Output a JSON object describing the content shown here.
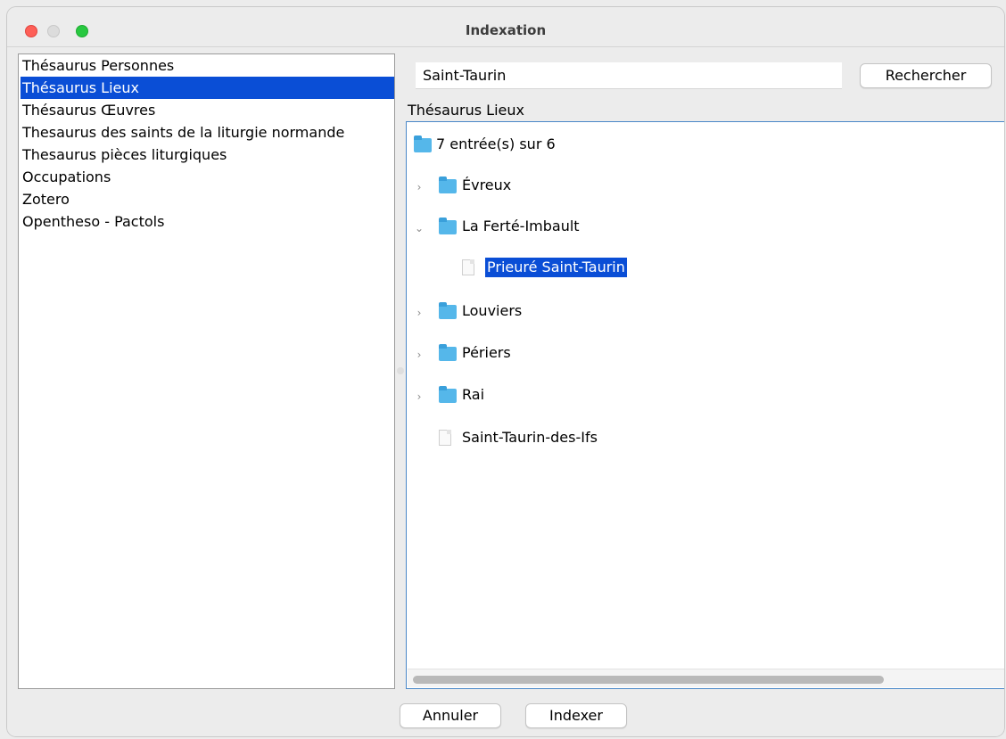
{
  "window": {
    "title": "Indexation"
  },
  "thesaurus_list": {
    "items": [
      {
        "label": "Thésaurus Personnes",
        "selected": false
      },
      {
        "label": "Thésaurus Lieux",
        "selected": true
      },
      {
        "label": "Thésaurus Œuvres",
        "selected": false
      },
      {
        "label": "Thesaurus des saints de la liturgie normande",
        "selected": false
      },
      {
        "label": "Thesaurus pièces liturgiques",
        "selected": false
      },
      {
        "label": "Occupations",
        "selected": false
      },
      {
        "label": "Zotero",
        "selected": false
      },
      {
        "label": "Opentheso - Pactols",
        "selected": false
      }
    ]
  },
  "search": {
    "value": "Saint-Taurin",
    "button_label": "Rechercher"
  },
  "tree": {
    "label": "Thésaurus Lieux",
    "root": "7 entrée(s) sur 6",
    "nodes": [
      {
        "label": "Évreux",
        "type": "folder",
        "state": "collapsed"
      },
      {
        "label": "La Ferté-Imbault",
        "type": "folder",
        "state": "expanded"
      },
      {
        "label": "Prieuré Saint-Taurin",
        "type": "leaf",
        "selected": true
      },
      {
        "label": "Louviers",
        "type": "folder",
        "state": "collapsed"
      },
      {
        "label": "Périers",
        "type": "folder",
        "state": "collapsed"
      },
      {
        "label": "Rai",
        "type": "folder",
        "state": "collapsed"
      },
      {
        "label": "Saint-Taurin-des-Ifs",
        "type": "leaf"
      }
    ]
  },
  "actions": {
    "cancel_label": "Annuler",
    "index_label": "Indexer"
  },
  "icons": {
    "folder": "folder-icon",
    "document": "document-icon",
    "chevron_right": "chevron-right-icon",
    "chevron_down": "chevron-down-icon"
  },
  "colors": {
    "selection": "#0a4ed6",
    "folder": "#55b7ea",
    "focus_border": "#4a88c8"
  }
}
